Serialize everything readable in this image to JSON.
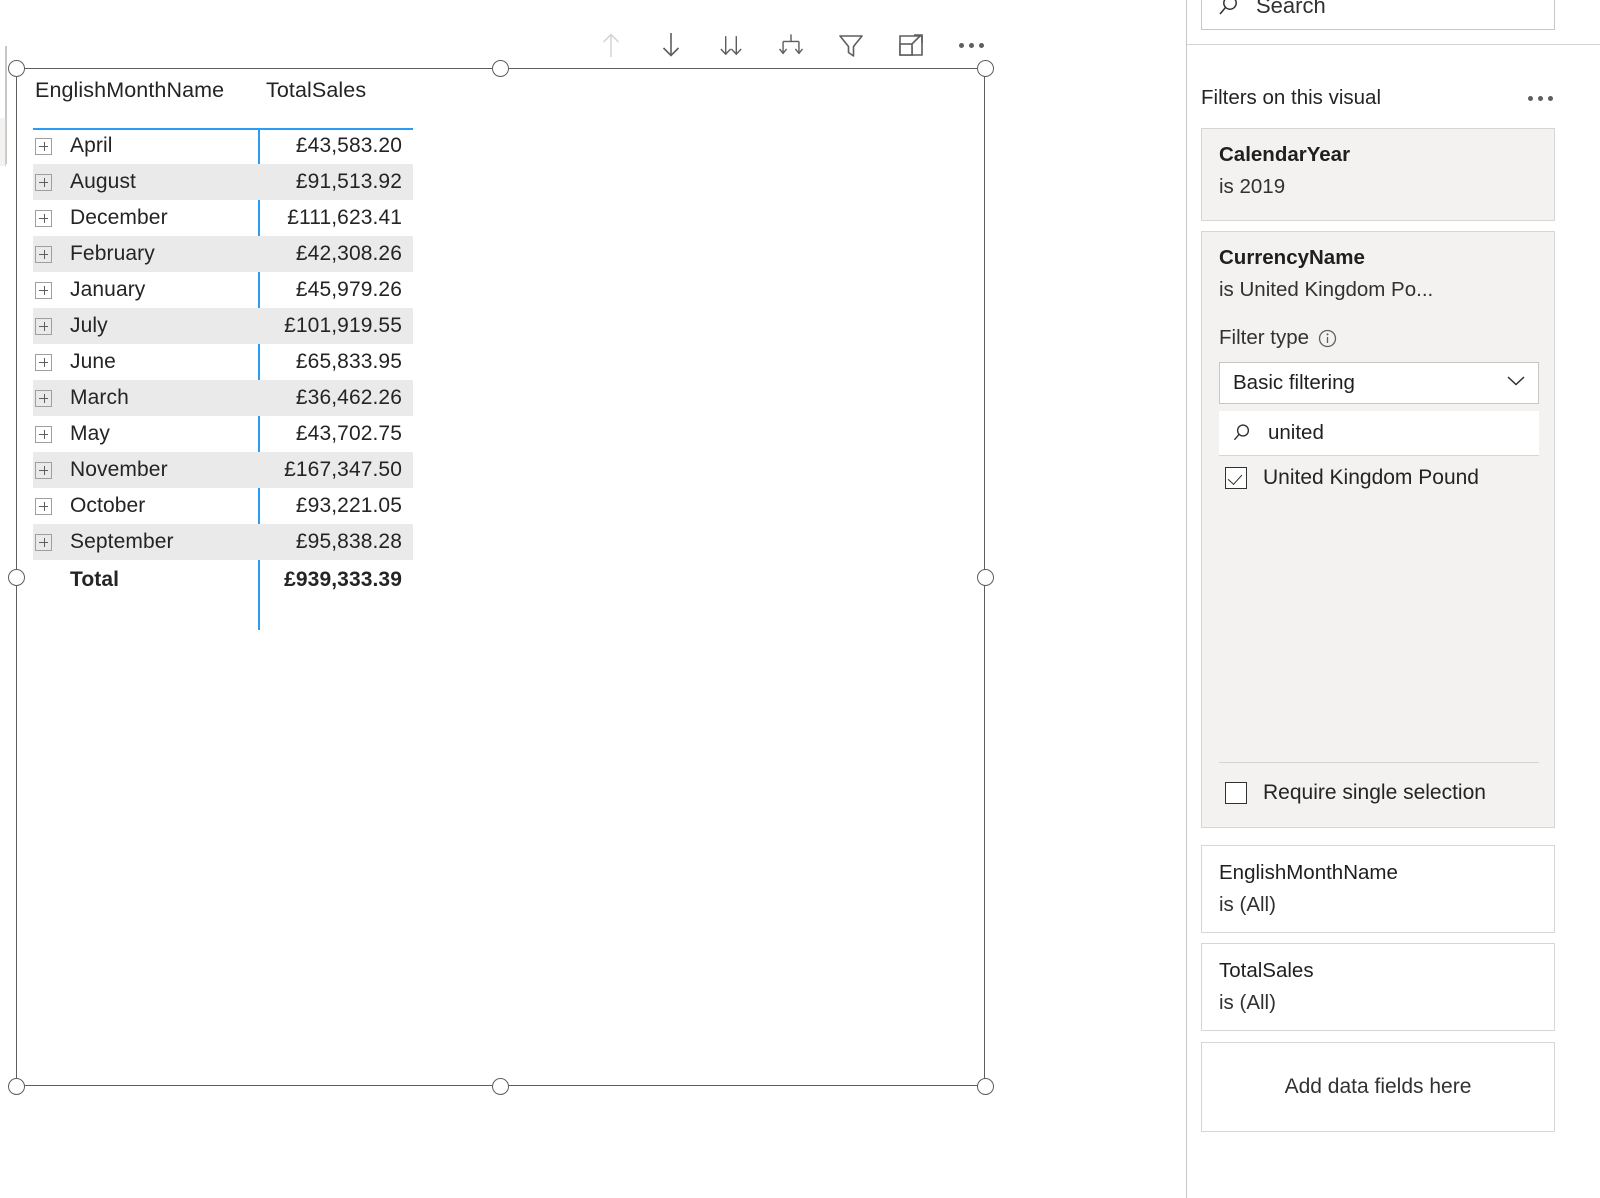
{
  "visual_toolbar": {
    "buttons": [
      {
        "name": "drill-up-icon",
        "label": "Drill up",
        "disabled": true
      },
      {
        "name": "drill-down-icon",
        "label": "Click to turn on Drill down",
        "disabled": false
      },
      {
        "name": "expand-all-down-icon",
        "label": "Go to the next level in the hierarchy",
        "disabled": false
      },
      {
        "name": "expand-hierarchy-icon",
        "label": "Expand all down one level in the hierarchy",
        "disabled": false
      },
      {
        "name": "filter-icon",
        "label": "Filters",
        "disabled": false
      },
      {
        "name": "focus-mode-icon",
        "label": "Focus mode",
        "disabled": false
      },
      {
        "name": "more-options-icon",
        "label": "More options",
        "disabled": false
      }
    ]
  },
  "matrix": {
    "columns": [
      "EnglishMonthName",
      "TotalSales"
    ],
    "rows": [
      {
        "category": "April",
        "value": "£43,583.20"
      },
      {
        "category": "August",
        "value": "£91,513.92"
      },
      {
        "category": "December",
        "value": "£111,623.41"
      },
      {
        "category": "February",
        "value": "£42,308.26"
      },
      {
        "category": "January",
        "value": "£45,979.26"
      },
      {
        "category": "July",
        "value": "£101,919.55"
      },
      {
        "category": "June",
        "value": "£65,833.95"
      },
      {
        "category": "March",
        "value": "£36,462.26"
      },
      {
        "category": "May",
        "value": "£43,702.75"
      },
      {
        "category": "November",
        "value": "£167,347.50"
      },
      {
        "category": "October",
        "value": "£93,221.05"
      },
      {
        "category": "September",
        "value": "£95,838.28"
      }
    ],
    "total": {
      "label": "Total",
      "value": "£939,333.39"
    },
    "accent_color": "#2b9bf4",
    "alt_row_color": "#eaeaea"
  },
  "filter_pane": {
    "search": {
      "placeholder": "Search",
      "value": "Search"
    },
    "header": {
      "title": "Filters on this visual",
      "more_label": "More options"
    },
    "cards": {
      "calendar_year": {
        "field": "CalendarYear",
        "condition": "is 2019"
      },
      "currency": {
        "field": "CurrencyName",
        "condition": "is United Kingdom Po...",
        "filter_type_label": "Filter type",
        "filter_type_value": "Basic filtering",
        "search_value": "united",
        "items": [
          {
            "label": "United Kingdom Pound",
            "checked": true
          }
        ],
        "require_single_selection": {
          "label": "Require single selection",
          "checked": false
        }
      },
      "month": {
        "field": "EnglishMonthName",
        "condition": "is (All)"
      },
      "total_sales": {
        "field": "TotalSales",
        "condition": "is (All)"
      },
      "add_field": {
        "label": "Add data fields here"
      }
    }
  }
}
